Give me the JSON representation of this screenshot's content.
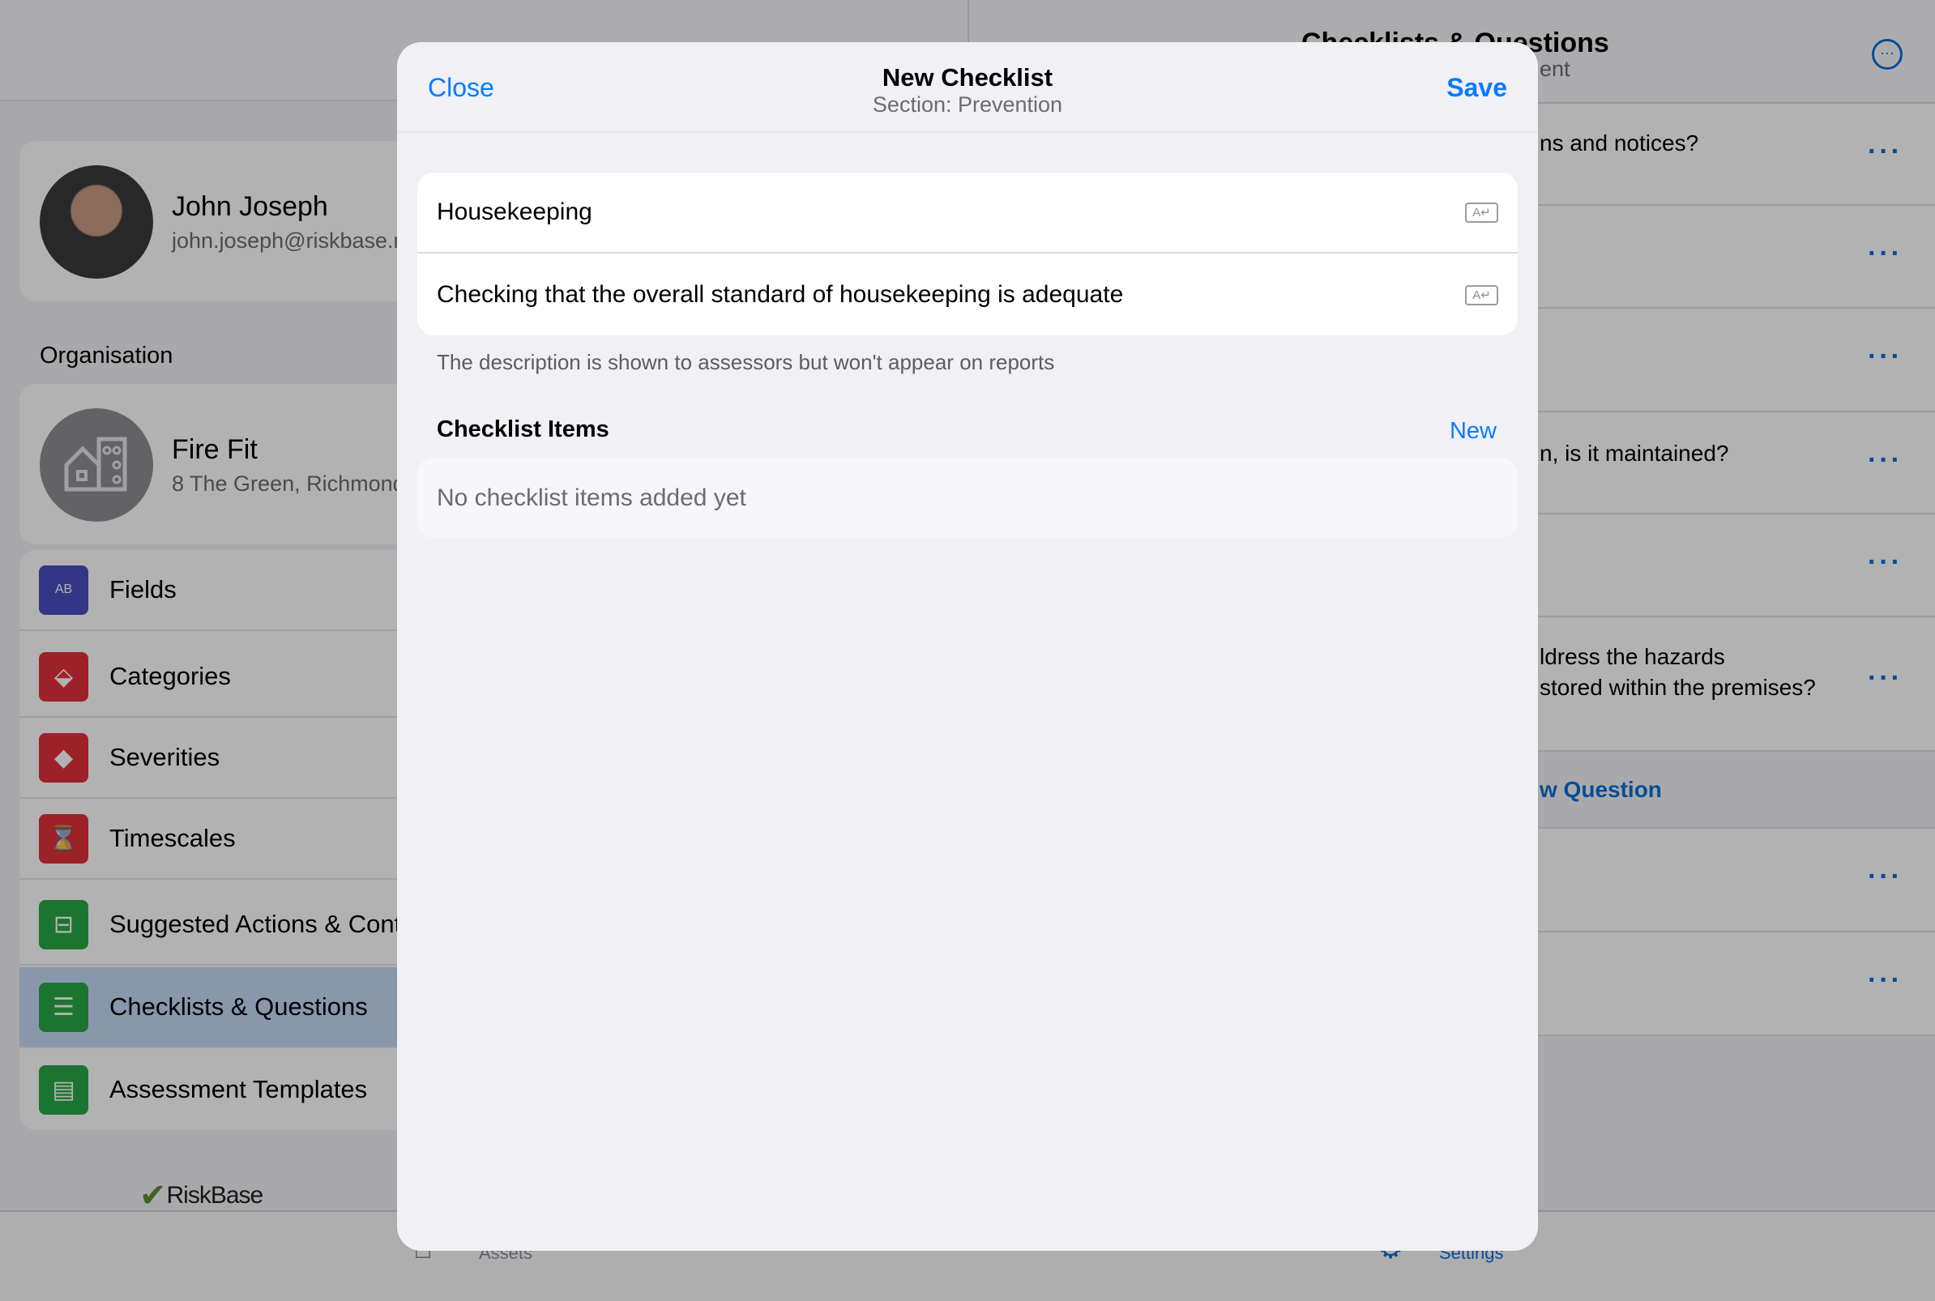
{
  "sidebar": {
    "profile": {
      "name": "John Joseph",
      "email": "john.joseph@riskbase.net"
    },
    "organisation_heading": "Organisation",
    "organisation": {
      "name": "Fire Fit",
      "address": "8 The Green, Richmond"
    },
    "items": [
      {
        "label": "Fields",
        "icon": "fields-icon",
        "color": "#4a4ec2"
      },
      {
        "label": "Categories",
        "icon": "tag-icon",
        "color": "#e0303a"
      },
      {
        "label": "Severities",
        "icon": "warning-icon",
        "color": "#e0303a"
      },
      {
        "label": "Timescales",
        "icon": "hourglass-icon",
        "color": "#e0303a"
      },
      {
        "label": "Suggested Actions & Controls",
        "icon": "signpost-icon",
        "color": "#28a745"
      },
      {
        "label": "Checklists & Questions",
        "icon": "checklist-icon",
        "color": "#28a745",
        "selected": true
      },
      {
        "label": "Assessment Templates",
        "icon": "template-icon",
        "color": "#28a745"
      }
    ],
    "logo": "RiskBase"
  },
  "detail": {
    "title": "Checklists & Questions",
    "subtitle_fragment": "ent",
    "rows": [
      {
        "text": "ns and notices?"
      },
      {
        "text": ""
      },
      {
        "text": ""
      },
      {
        "text": "n, is it maintained?"
      },
      {
        "text": ""
      },
      {
        "text": "ldress the hazards",
        "text2": "stored within the premises?"
      }
    ],
    "new_question": "w Question",
    "rows_after": [
      {
        "text": ""
      },
      {
        "text": ""
      }
    ]
  },
  "tabbar": {
    "assets": "Assets",
    "settings": "Settings"
  },
  "modal": {
    "close": "Close",
    "title": "New Checklist",
    "subtitle": "Section: Prevention",
    "save": "Save",
    "name_value": "Housekeeping",
    "description_value": "Checking that the overall standard of housekeeping is adequate",
    "footnote": "The description is shown to assessors but won't appear on reports",
    "items_heading": "Checklist Items",
    "new_item": "New",
    "empty_text": "No checklist items added yet"
  },
  "colors": {
    "accent": "#0a7aff",
    "selected": "#c5d8f5"
  }
}
